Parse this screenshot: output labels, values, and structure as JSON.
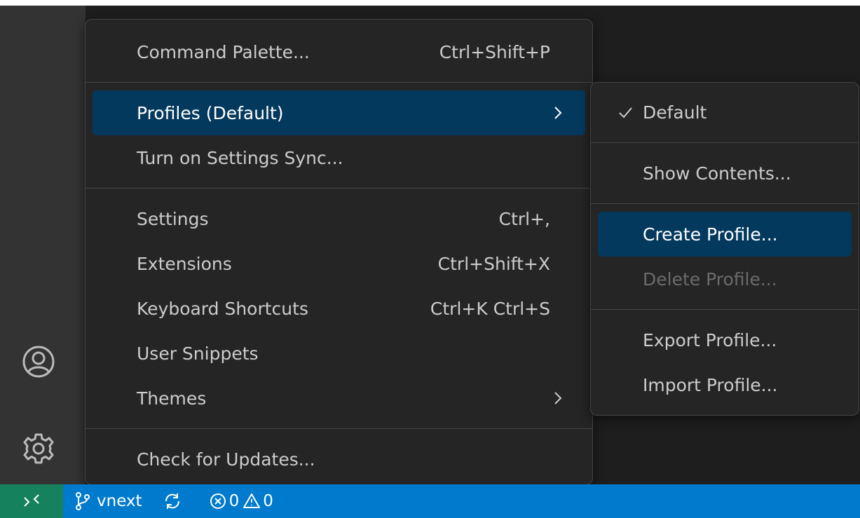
{
  "main_menu": {
    "items": [
      {
        "label": "Command Palette...",
        "shortcut": "Ctrl+Shift+P"
      },
      {
        "label": "Profiles (Default)",
        "shortcut": ""
      },
      {
        "label": "Turn on Settings Sync...",
        "shortcut": ""
      },
      {
        "label": "Settings",
        "shortcut": "Ctrl+,"
      },
      {
        "label": "Extensions",
        "shortcut": "Ctrl+Shift+X"
      },
      {
        "label": "Keyboard Shortcuts",
        "shortcut": "Ctrl+K Ctrl+S"
      },
      {
        "label": "User Snippets",
        "shortcut": ""
      },
      {
        "label": "Themes",
        "shortcut": ""
      },
      {
        "label": "Check for Updates...",
        "shortcut": ""
      }
    ],
    "active_item": "Profiles (Default)"
  },
  "profiles_menu": {
    "items": [
      {
        "label": "Default",
        "checked": true
      },
      {
        "label": "Show Contents..."
      },
      {
        "label": "Create Profile..."
      },
      {
        "label": "Delete Profile...",
        "disabled": true
      },
      {
        "label": "Export Profile..."
      },
      {
        "label": "Import Profile..."
      }
    ],
    "active_item": "Create Profile..."
  },
  "status_bar": {
    "branch": "vnext",
    "errors": "0",
    "warnings": "0"
  },
  "icons": {
    "accounts": "account-icon",
    "manage": "gear-icon",
    "remote": "remote-icon",
    "branch": "git-branch-icon",
    "sync": "sync-icon",
    "error": "error-icon",
    "warning": "warning-icon",
    "chevron": "chevron-right-icon",
    "check": "check-icon"
  },
  "colors": {
    "menu_background": "#252526",
    "menu_selection": "#04395e",
    "status_bar": "#007acc",
    "remote_indicator": "#16825d",
    "activity_bar": "#333333",
    "editor_background": "#1e1e1e"
  }
}
